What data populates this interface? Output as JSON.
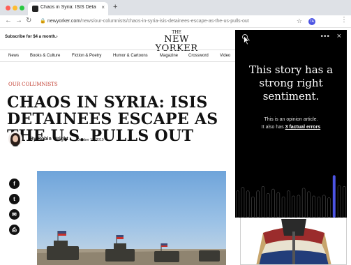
{
  "browser": {
    "tab_title": "Chaos in Syria: ISIS Detainees",
    "tab_close": "×",
    "new_tab": "+",
    "url_domain": "newyorker.com",
    "url_path": "/news/our-columnists/chaos-in-syria-isis-detainees-escape-as-the-us-pulls-out",
    "extension_badge": "TA"
  },
  "header": {
    "subscribe": "Subscribe for $4 a month.›",
    "logo_the": "THE",
    "logo_main": "NEW YORKER"
  },
  "nav": [
    "News",
    "Books & Culture",
    "Fiction & Poetry",
    "Humor & Cartoons",
    "Magazine",
    "Crossword",
    "Video"
  ],
  "article": {
    "kicker": "OUR COLUMNISTS",
    "headline": "CHAOS IN SYRIA: ISIS DETAINEES ESCAPE AS THE U.S. PULLS OUT",
    "byline": "By Robin Wright",
    "date": "October 13, 2019"
  },
  "share": {
    "facebook": "f",
    "twitter": "t",
    "email": "✉",
    "print": "⎙"
  },
  "overlay": {
    "headline": "This story has a strong right sentiment.",
    "sub_line1": "This is an opinion article.",
    "sub_line2_prefix": "It also has ",
    "sub_link": "3 factual errors",
    "more": "•••",
    "close": "×",
    "accent": "#4c54e3",
    "bars": [
      0.62,
      0.7,
      0.62,
      0.48,
      0.62,
      0.72,
      0.56,
      0.66,
      0.58,
      0.48,
      0.62,
      0.5,
      0.52,
      0.68,
      0.6,
      0.5,
      0.48,
      0.52,
      0.46,
      0.98,
      0.74,
      0.72
    ]
  }
}
